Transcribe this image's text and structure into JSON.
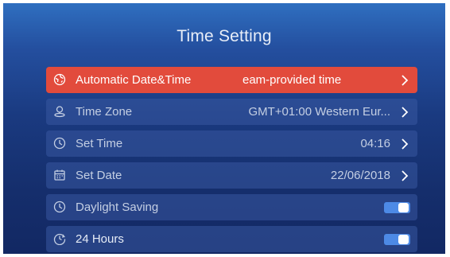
{
  "screen": {
    "title": "Time Setting"
  },
  "menu": {
    "items": [
      {
        "label": "Automatic Date&Time",
        "value": "eam-provided time",
        "icon": "globe-clock-icon",
        "selected": true
      },
      {
        "label": "Time Zone",
        "value": "GMT+01:00 Western Eur...",
        "icon": "location-pin-icon"
      },
      {
        "label": "Set Time",
        "value": "04:16",
        "icon": "clock-icon"
      },
      {
        "label": "Set Date",
        "value": "22/06/2018",
        "icon": "calendar-icon"
      },
      {
        "label": "Daylight Saving",
        "toggle": true,
        "icon": "clock-icon"
      },
      {
        "label": "24 Hours",
        "toggle": true,
        "icon": "clock-24-icon"
      }
    ]
  },
  "colors": {
    "selected_row": "#e24b3c",
    "row_background": "#2a4a94",
    "toggle_on": "#4d8ae6"
  }
}
